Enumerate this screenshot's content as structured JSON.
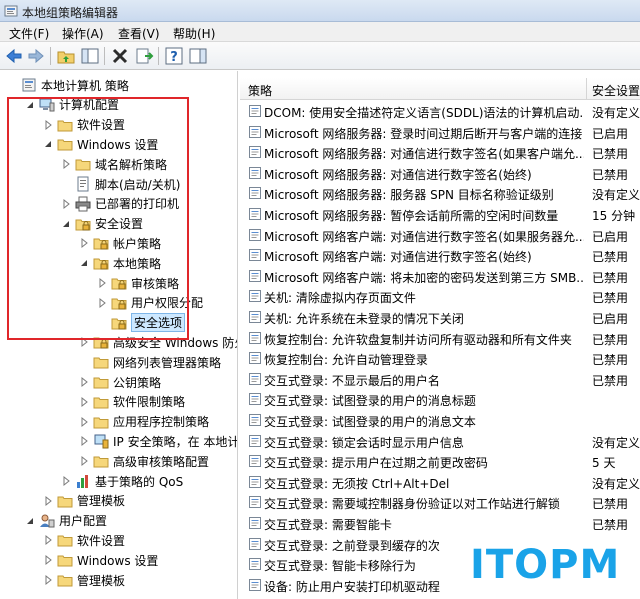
{
  "window": {
    "title": "本地组策略编辑器"
  },
  "menu": [
    "文件(F)",
    "操作(A)",
    "查看(V)",
    "帮助(H)"
  ],
  "tree": [
    {
      "label": "本地计算机 策略",
      "level": 0,
      "icon": "computer-policy-icon",
      "expander": "none"
    },
    {
      "label": "计算机配置",
      "level": 1,
      "icon": "computer-icon",
      "expander": "open"
    },
    {
      "label": "软件设置",
      "level": 2,
      "icon": "folder-icon",
      "expander": "closed"
    },
    {
      "label": "Windows 设置",
      "level": 2,
      "icon": "folder-icon",
      "expander": "open"
    },
    {
      "label": "域名解析策略",
      "level": 3,
      "icon": "folder-icon",
      "expander": "closed"
    },
    {
      "label": "脚本(启动/关机)",
      "level": 3,
      "icon": "script-icon",
      "expander": "none"
    },
    {
      "label": "已部署的打印机",
      "level": 3,
      "icon": "printer-icon",
      "expander": "closed"
    },
    {
      "label": "安全设置",
      "level": 3,
      "icon": "security-folder-icon",
      "expander": "open"
    },
    {
      "label": "帐户策略",
      "level": 4,
      "icon": "security-folder-icon",
      "expander": "closed"
    },
    {
      "label": "本地策略",
      "level": 4,
      "icon": "security-folder-icon",
      "expander": "open"
    },
    {
      "label": "审核策略",
      "level": 5,
      "icon": "security-folder-icon",
      "expander": "closed"
    },
    {
      "label": "用户权限分配",
      "level": 5,
      "icon": "security-folder-icon",
      "expander": "closed"
    },
    {
      "label": "安全选项",
      "level": 5,
      "icon": "security-folder-icon",
      "expander": "none",
      "selected": true
    },
    {
      "label": "高级安全 Windows 防火墙",
      "level": 4,
      "icon": "security-folder-icon",
      "expander": "closed"
    },
    {
      "label": "网络列表管理器策略",
      "level": 4,
      "icon": "folder-icon",
      "expander": "none"
    },
    {
      "label": "公钥策略",
      "level": 4,
      "icon": "folder-icon",
      "expander": "closed"
    },
    {
      "label": "软件限制策略",
      "level": 4,
      "icon": "folder-icon",
      "expander": "closed"
    },
    {
      "label": "应用程序控制策略",
      "level": 4,
      "icon": "folder-icon",
      "expander": "closed"
    },
    {
      "label": "IP 安全策略，在 本地计算机",
      "level": 4,
      "icon": "ip-security-icon",
      "expander": "closed"
    },
    {
      "label": "高级审核策略配置",
      "level": 4,
      "icon": "folder-icon",
      "expander": "closed"
    },
    {
      "label": "基于策略的 QoS",
      "level": 3,
      "icon": "chart-icon",
      "expander": "closed"
    },
    {
      "label": "管理模板",
      "level": 2,
      "icon": "folder-icon",
      "expander": "closed"
    },
    {
      "label": "用户配置",
      "level": 1,
      "icon": "user-icon",
      "expander": "open"
    },
    {
      "label": "软件设置",
      "level": 2,
      "icon": "folder-icon",
      "expander": "closed"
    },
    {
      "label": "Windows 设置",
      "level": 2,
      "icon": "folder-icon",
      "expander": "closed"
    },
    {
      "label": "管理模板",
      "level": 2,
      "icon": "folder-icon",
      "expander": "closed"
    }
  ],
  "columns": {
    "policy": "策略",
    "setting": "安全设置"
  },
  "policies": [
    {
      "name": "DCOM: 使用安全描述符定义语言(SDDL)语法的计算机启动...",
      "value": "没有定义"
    },
    {
      "name": "Microsoft 网络服务器: 登录时间过期后断开与客户端的连接",
      "value": "已启用"
    },
    {
      "name": "Microsoft 网络服务器: 对通信进行数字签名(如果客户端允...",
      "value": "已禁用"
    },
    {
      "name": "Microsoft 网络服务器: 对通信进行数字签名(始终)",
      "value": "已禁用"
    },
    {
      "name": "Microsoft 网络服务器: 服务器 SPN 目标名称验证级别",
      "value": "没有定义"
    },
    {
      "name": "Microsoft 网络服务器: 暂停会话前所需的空闲时间数量",
      "value": "15 分钟"
    },
    {
      "name": "Microsoft 网络客户端: 对通信进行数字签名(如果服务器允...",
      "value": "已启用"
    },
    {
      "name": "Microsoft 网络客户端: 对通信进行数字签名(始终)",
      "value": "已禁用"
    },
    {
      "name": "Microsoft 网络客户端: 将未加密的密码发送到第三方 SMB...",
      "value": "已禁用"
    },
    {
      "name": "关机: 清除虚拟内存页面文件",
      "value": "已禁用"
    },
    {
      "name": "关机: 允许系统在未登录的情况下关闭",
      "value": "已启用"
    },
    {
      "name": "恢复控制台: 允许软盘复制并访问所有驱动器和所有文件夹",
      "value": "已禁用"
    },
    {
      "name": "恢复控制台: 允许自动管理登录",
      "value": "已禁用"
    },
    {
      "name": "交互式登录: 不显示最后的用户名",
      "value": "已禁用"
    },
    {
      "name": "交互式登录: 试图登录的用户的消息标题",
      "value": ""
    },
    {
      "name": "交互式登录: 试图登录的用户的消息文本",
      "value": ""
    },
    {
      "name": "交互式登录: 锁定会话时显示用户信息",
      "value": "没有定义"
    },
    {
      "name": "交互式登录: 提示用户在过期之前更改密码",
      "value": "5 天"
    },
    {
      "name": "交互式登录: 无须按 Ctrl+Alt+Del",
      "value": "没有定义"
    },
    {
      "name": "交互式登录: 需要域控制器身份验证以对工作站进行解锁",
      "value": "已禁用"
    },
    {
      "name": "交互式登录: 需要智能卡",
      "value": "已禁用"
    },
    {
      "name": "交互式登录: 之前登录到缓存的次数(域控",
      "value": ""
    },
    {
      "name": "交互式登录: 智能卡移除行为",
      "value": ""
    },
    {
      "name": "设备: 防止用户安装打印机驱动程序",
      "value": ""
    }
  ],
  "watermark": {
    "text": "ITOPM"
  }
}
